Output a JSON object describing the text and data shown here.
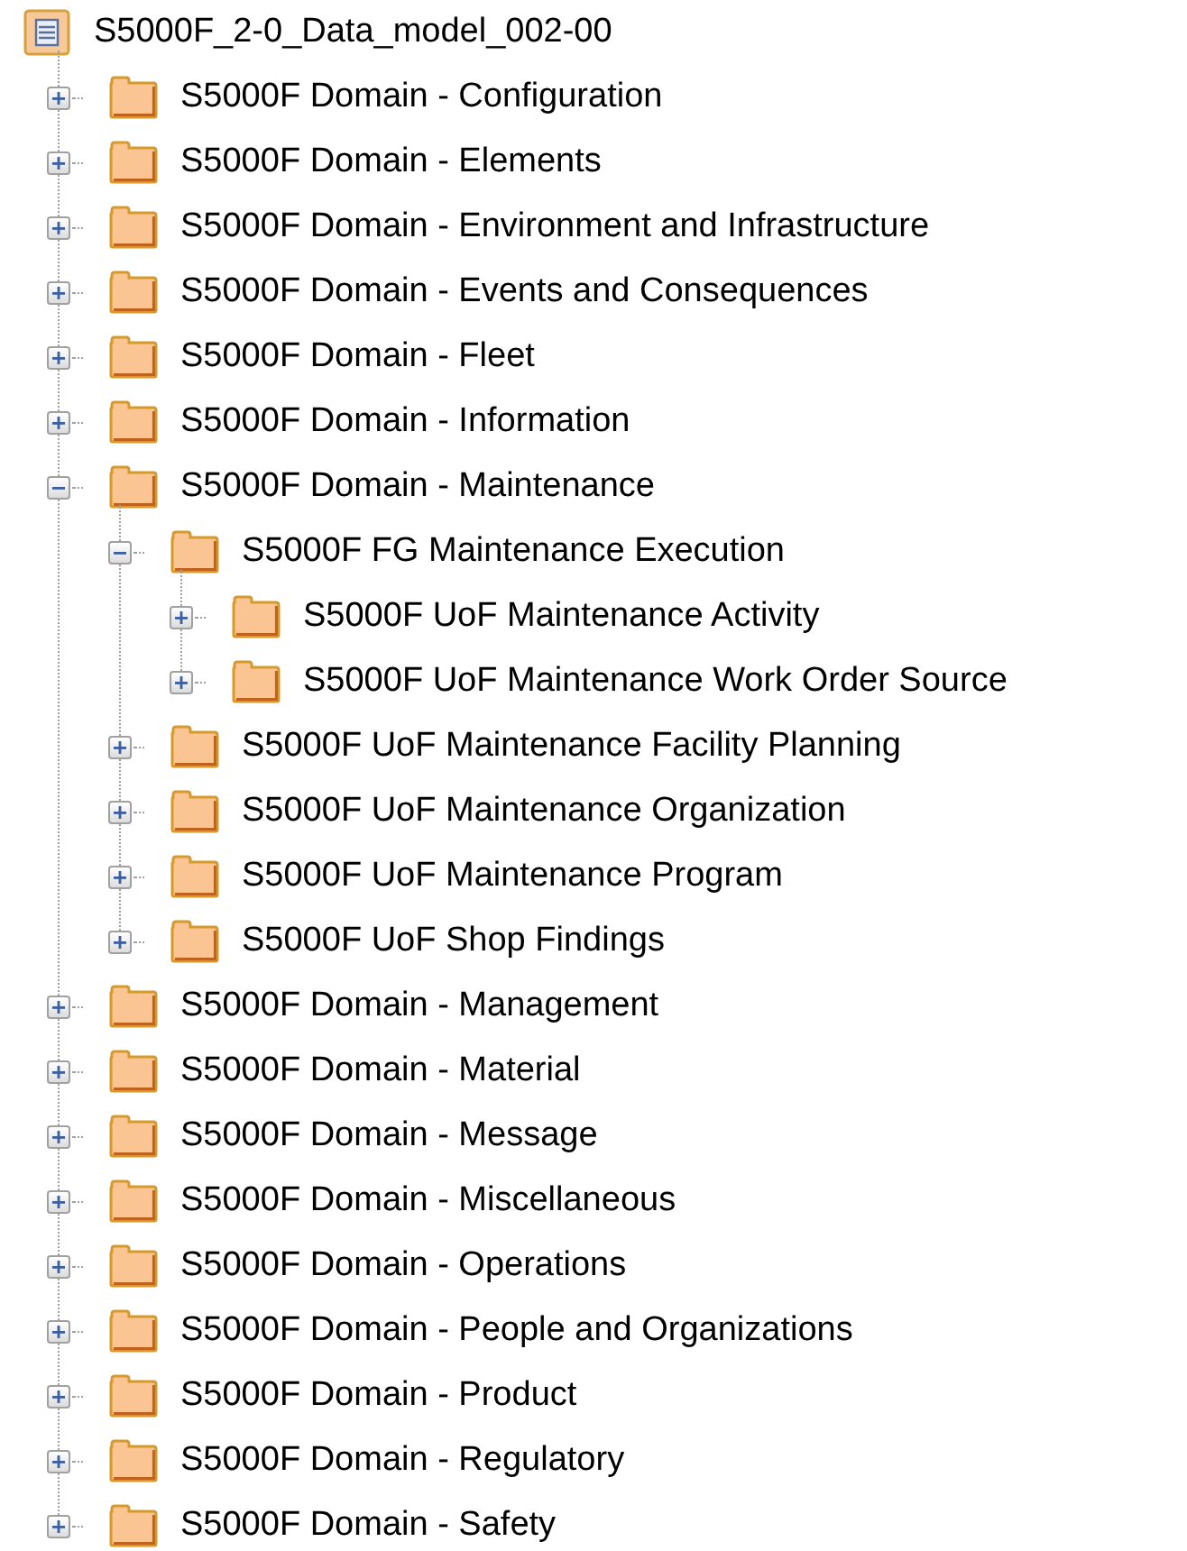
{
  "root": {
    "label": "S5000F_2-0_Data_model_002-00"
  },
  "items": [
    {
      "label": "S5000F Domain - Configuration",
      "expanded": false
    },
    {
      "label": "S5000F Domain - Elements",
      "expanded": false
    },
    {
      "label": "S5000F Domain - Environment and Infrastructure",
      "expanded": false
    },
    {
      "label": "S5000F Domain - Events and Consequences",
      "expanded": false
    },
    {
      "label": "S5000F Domain - Fleet",
      "expanded": false
    },
    {
      "label": "S5000F Domain - Information",
      "expanded": false
    },
    {
      "label": "S5000F Domain - Maintenance",
      "expanded": true,
      "children": [
        {
          "label": "S5000F FG Maintenance Execution",
          "expanded": true,
          "children": [
            {
              "label": "S5000F UoF Maintenance Activity",
              "expanded": false
            },
            {
              "label": "S5000F UoF Maintenance Work Order Source",
              "expanded": false
            }
          ]
        },
        {
          "label": "S5000F UoF Maintenance Facility Planning",
          "expanded": false
        },
        {
          "label": "S5000F UoF Maintenance Organization",
          "expanded": false
        },
        {
          "label": "S5000F UoF Maintenance Program",
          "expanded": false
        },
        {
          "label": "S5000F UoF Shop Findings",
          "expanded": false
        }
      ]
    },
    {
      "label": "S5000F Domain - Management",
      "expanded": false
    },
    {
      "label": "S5000F Domain - Material",
      "expanded": false
    },
    {
      "label": "S5000F Domain - Message",
      "expanded": false
    },
    {
      "label": "S5000F Domain - Miscellaneous",
      "expanded": false
    },
    {
      "label": "S5000F Domain - Operations",
      "expanded": false
    },
    {
      "label": "S5000F Domain - People and Organizations",
      "expanded": false
    },
    {
      "label": "S5000F Domain - Product",
      "expanded": false
    },
    {
      "label": "S5000F Domain - Regulatory",
      "expanded": false
    },
    {
      "label": "S5000F Domain - Safety",
      "expanded": false
    }
  ]
}
